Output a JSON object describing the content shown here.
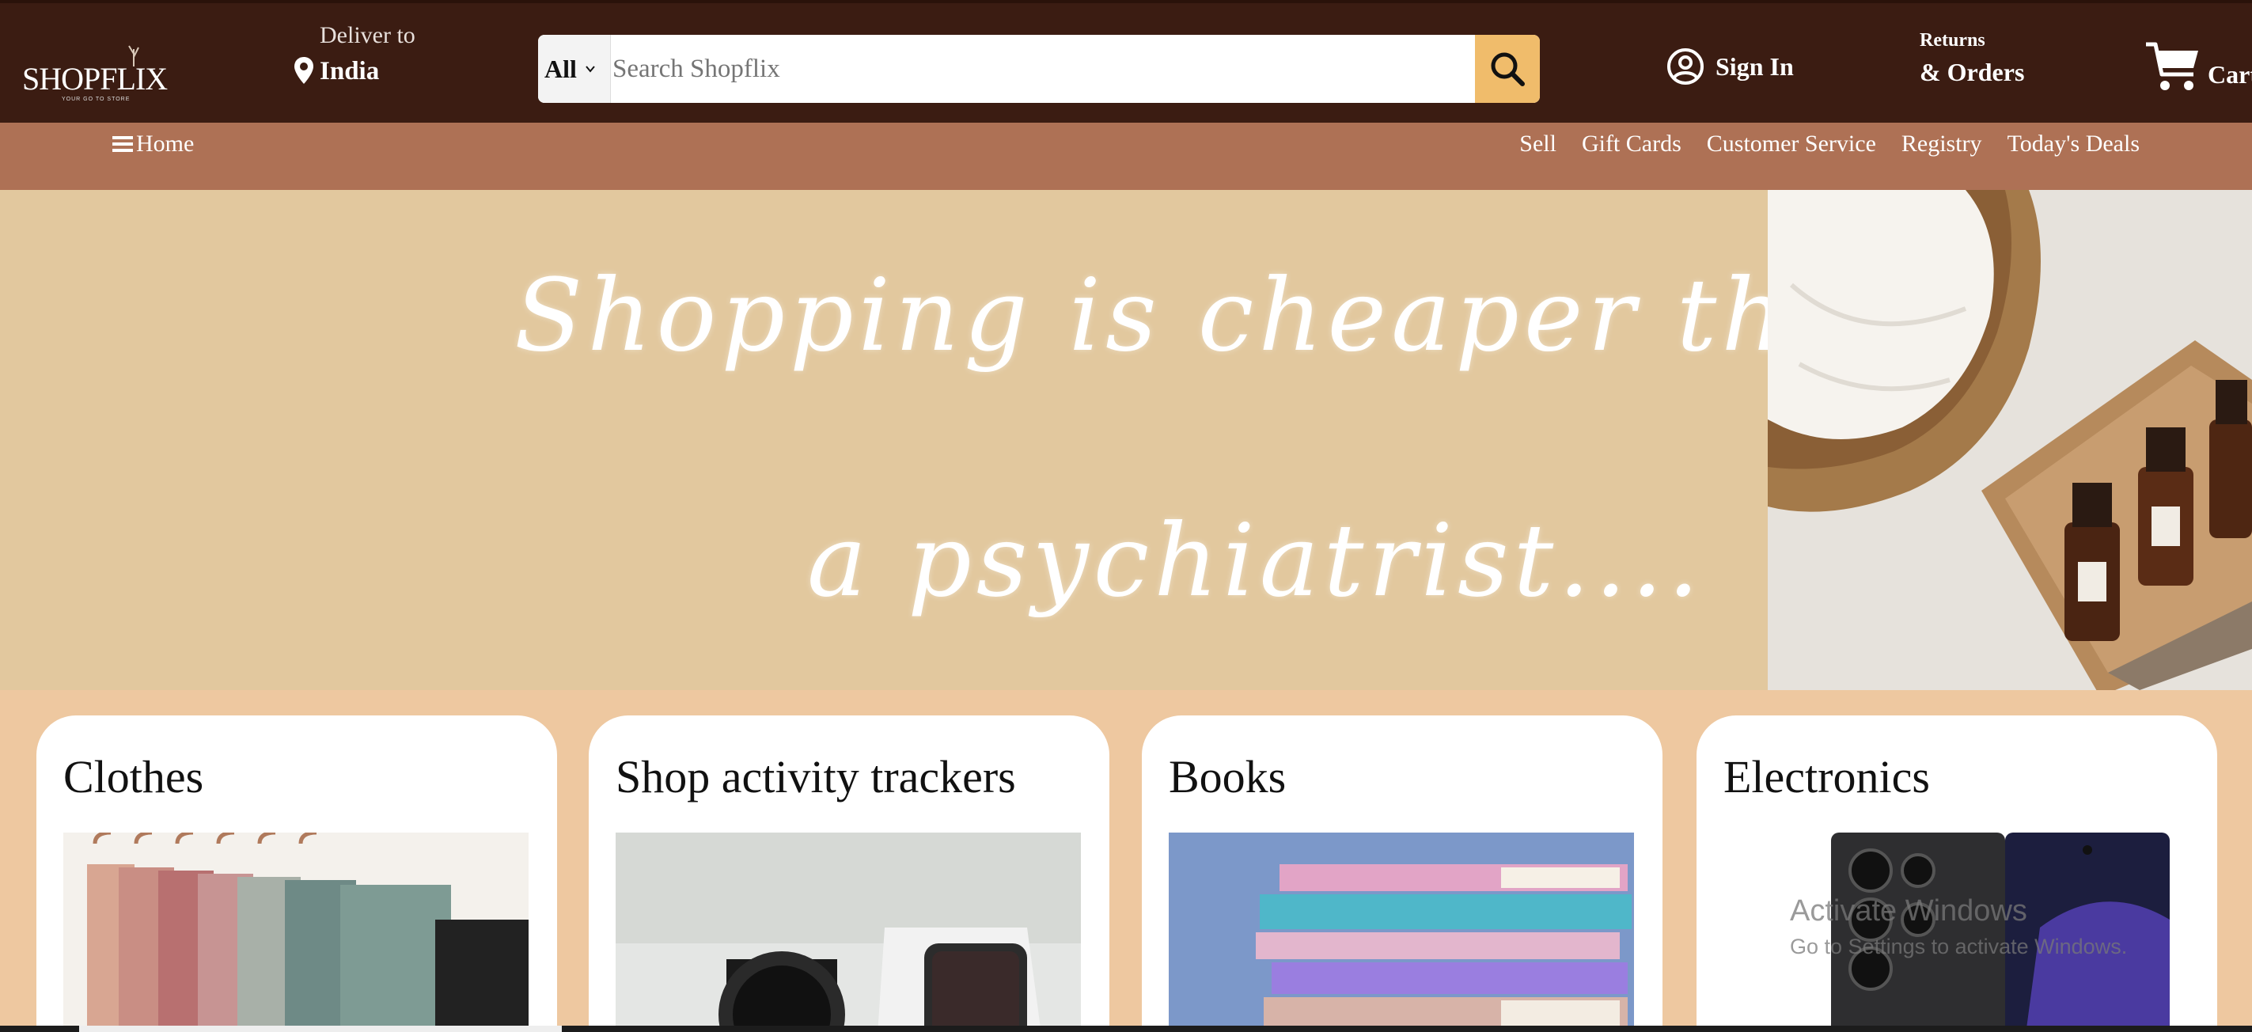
{
  "header": {
    "logo_text": "SHOPFLIX",
    "logo_tagline": "YOUR GO TO STORE",
    "deliver_label": "Deliver to",
    "deliver_country": "India",
    "search_category": "All",
    "search_placeholder": "Search Shopflix",
    "search_value": "",
    "signin_label": "Sign In",
    "returns_label": "Returns",
    "orders_label": "& Orders",
    "cart_label": "Cart"
  },
  "subnav": {
    "home_label": "Home",
    "links": [
      "Sell",
      "Gift Cards",
      "Customer Service",
      "Registry",
      "Today's Deals"
    ]
  },
  "hero": {
    "line1": "Shopping is cheaper than",
    "line2": "a psychiatrist...."
  },
  "cards": [
    {
      "title": "Clothes"
    },
    {
      "title": "Shop activity trackers"
    },
    {
      "title": "Books"
    },
    {
      "title": "Electronics"
    }
  ],
  "watermark": {
    "line1": "Activate Windows",
    "line2": "Go to Settings to activate Windows."
  },
  "colors": {
    "nav_bg": "#3b1c12",
    "subnav_bg": "#ae7155",
    "hero_bg": "#e2c89e",
    "cards_bg": "#eec8a0",
    "search_button": "#f0bc6b"
  },
  "icons": {
    "location": "map-pin-icon",
    "search": "search-icon",
    "user": "user-circle-icon",
    "cart": "shopping-cart-icon",
    "menu": "hamburger-menu-icon"
  }
}
